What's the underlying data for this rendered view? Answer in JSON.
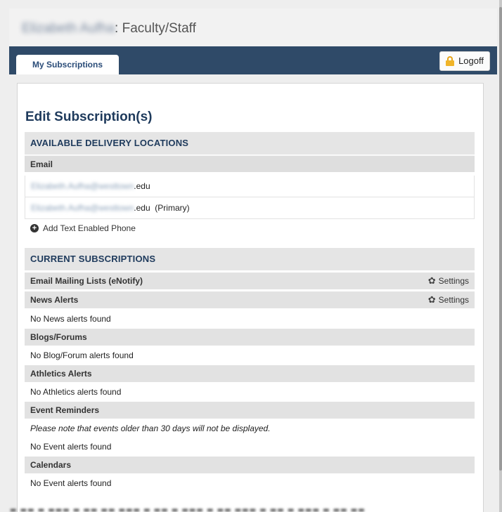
{
  "header": {
    "user_name": "Elizabeth Aufha",
    "role": ": Faculty/Staff"
  },
  "nav": {
    "tab_label": "My Subscriptions",
    "logoff_label": "Logoff"
  },
  "main": {
    "heading": "Edit Subscription(s)",
    "delivery": {
      "section_title": "AVAILABLE DELIVERY LOCATIONS",
      "email_header": "Email",
      "emails": [
        {
          "local": "Elizabeth.Aufha@westtown",
          "domain": ".edu",
          "suffix": ""
        },
        {
          "local": "Elizabeth.Aufha@westtown",
          "domain": ".edu",
          "suffix": "  (Primary)"
        }
      ],
      "add_phone_label": "Add Text Enabled Phone"
    },
    "subscriptions": {
      "section_title": "CURRENT SUBSCRIPTIONS",
      "settings_label": "Settings",
      "categories": [
        {
          "title": "Email Mailing Lists (eNotify)"
        },
        {
          "title": "News Alerts",
          "message": "No News alerts found"
        },
        {
          "title": "Blogs/Forums",
          "message": "No Blog/Forum alerts found"
        },
        {
          "title": "Athletics Alerts",
          "message": "No Athletics alerts found"
        },
        {
          "title": "Event Reminders",
          "note": "Please note that events older than 30 days will not be displayed.",
          "message": "No Event alerts found"
        },
        {
          "title": "Calendars",
          "message": "No Event alerts found"
        }
      ]
    }
  },
  "icons": {
    "lock": "lock-icon",
    "plus": "plus-circle-icon",
    "gear": "gear-icon"
  },
  "colors": {
    "nav_bg": "#2f4a68",
    "heading": "#1e3a5c",
    "lock": "#f0b429"
  }
}
